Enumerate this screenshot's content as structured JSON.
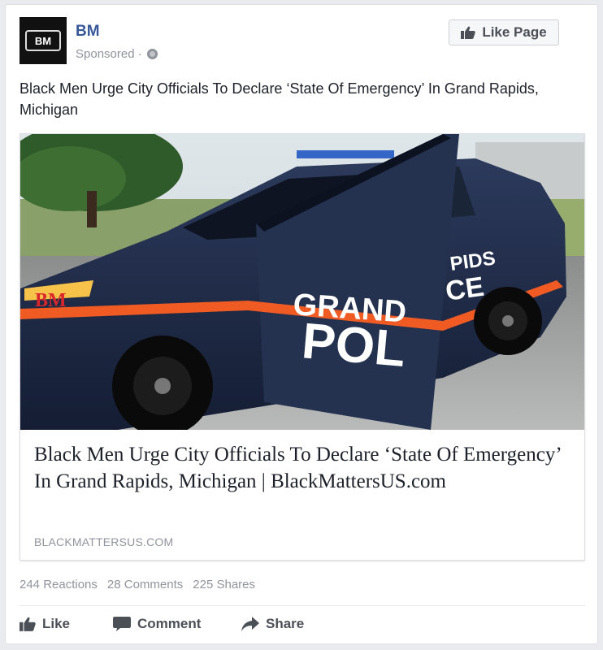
{
  "post": {
    "page_name": "BM",
    "avatar_text": "BM",
    "sponsored_label": "Sponsored · ",
    "like_page_label": "Like Page",
    "text": "Black Men Urge City Officials To Declare ‘State Of Emergency’ In Grand Rapids, Michigan"
  },
  "link": {
    "title": "Black Men Urge City Officials To Declare ‘State Of Emergency’ In Grand Rapids, Michigan | BlackMattersUS.com",
    "domain": "BLACKMATTERSUS.COM",
    "image": {
      "watermark": "BM",
      "door_text_1": "GRAND",
      "door_text_2": "POL",
      "rear_text_1": "PIDS",
      "rear_text_2": "CE"
    }
  },
  "stats": {
    "reactions": "244 Reactions",
    "comments": "28 Comments",
    "shares": "225 Shares"
  },
  "actions": {
    "like": "Like",
    "comment": "Comment",
    "share": "Share"
  },
  "colors": {
    "link_blue": "#365899",
    "muted": "#90949c",
    "police_navy": "#1d2a45",
    "stripe_orange": "#f05a23"
  }
}
